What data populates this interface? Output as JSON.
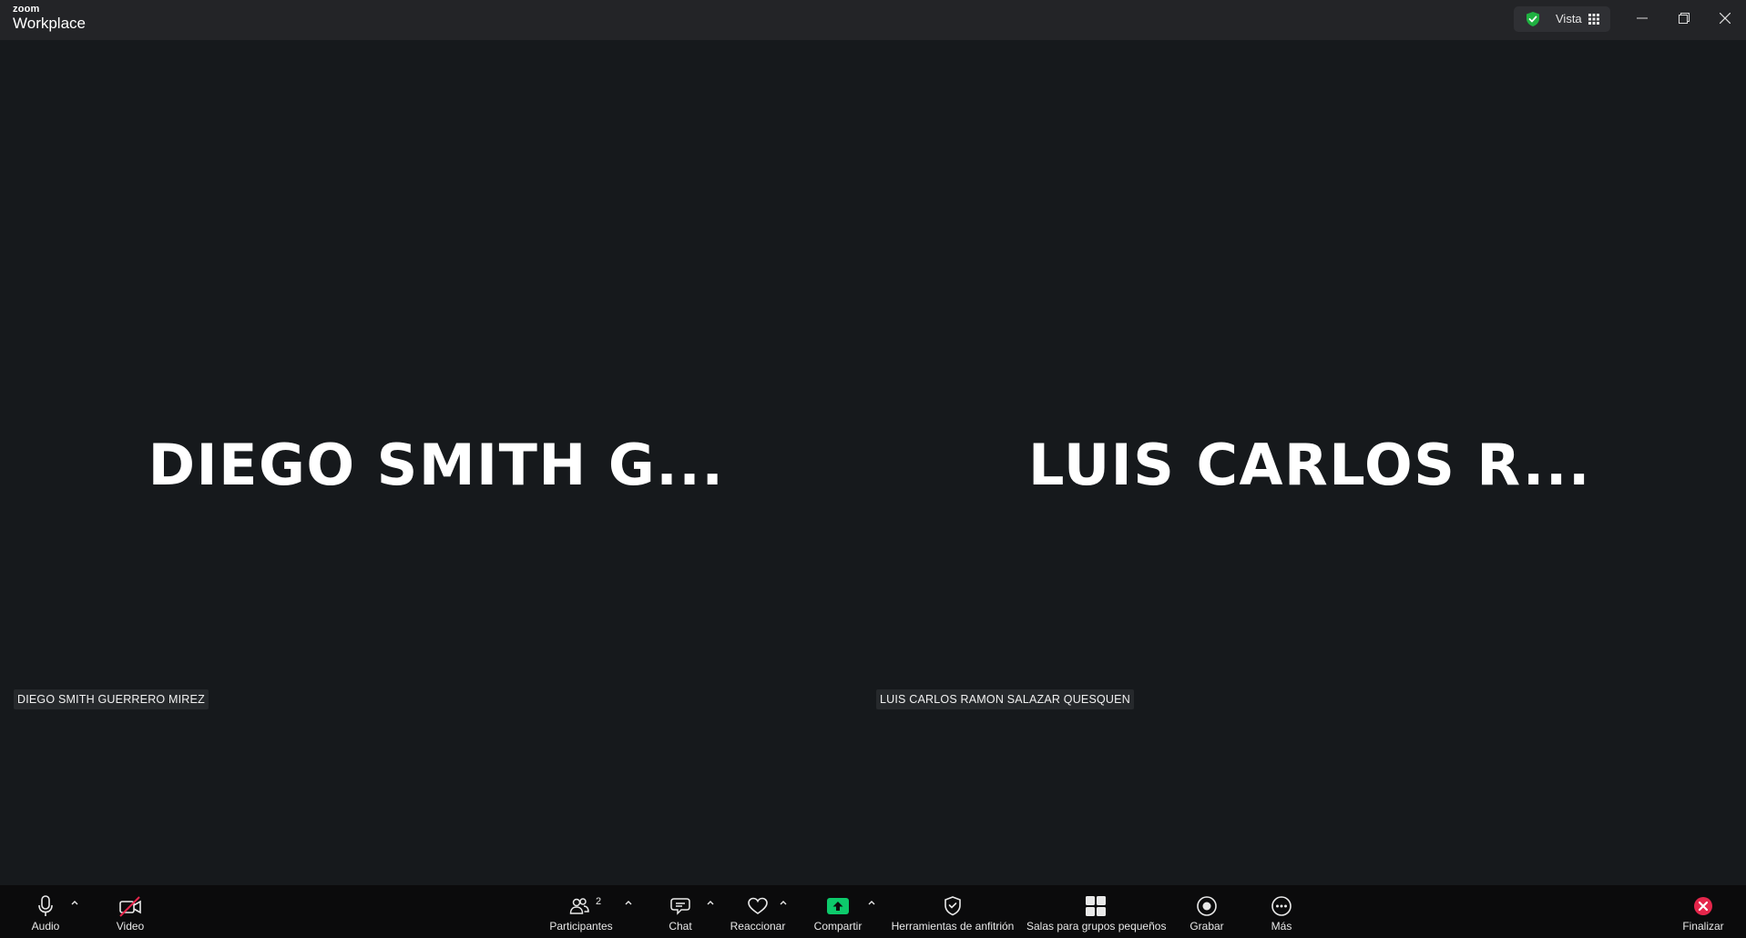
{
  "app": {
    "logo_small": "zoom",
    "logo_big": "Workplace"
  },
  "titlebar": {
    "view_label": "Vista",
    "shield_color": "#1fb141"
  },
  "participants": [
    {
      "display_name": "DIEGO SMITH G...",
      "full_name": "DIEGO SMITH GUERRERO MIREZ"
    },
    {
      "display_name": "LUIS CARLOS R...",
      "full_name": "LUIS CARLOS RAMON SALAZAR QUESQUEN"
    }
  ],
  "toolbar": {
    "audio": "Audio",
    "video": "Video",
    "participants": "Participantes",
    "participants_count": "2",
    "chat": "Chat",
    "react": "Reaccionar",
    "share": "Compartir",
    "host_tools": "Herramientas de anfitrión",
    "breakout": "Salas para grupos pequeños",
    "record": "Grabar",
    "more": "Más",
    "end": "Finalizar",
    "share_color": "#0dca6b",
    "end_color": "#e5264b",
    "video_off_color": "#e5264b"
  }
}
